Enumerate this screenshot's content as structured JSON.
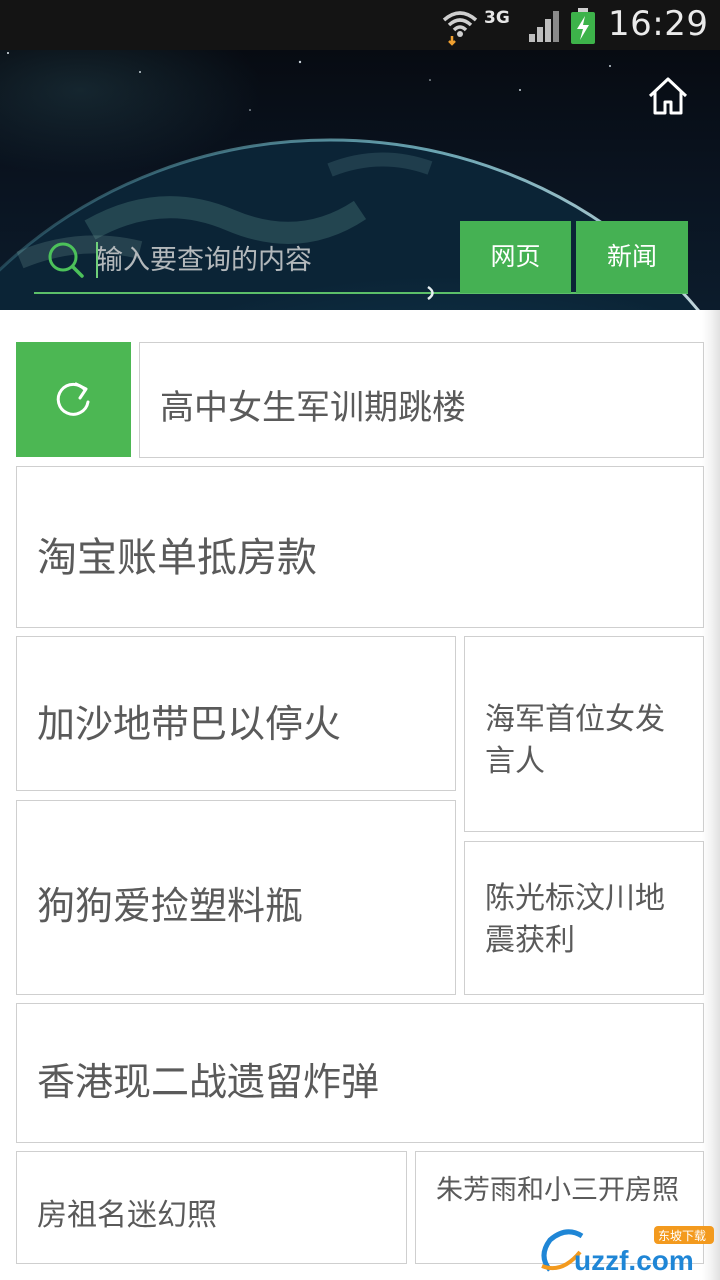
{
  "status_bar": {
    "network": "3G",
    "time": "16:29",
    "icons": [
      "wifi-icon",
      "signal-icon",
      "battery-charging-icon"
    ]
  },
  "header": {
    "home_icon": "home-icon",
    "search": {
      "icon": "search-icon",
      "placeholder": "输入要查询的内容",
      "value": ""
    },
    "buttons": {
      "web": "网页",
      "news": "新闻"
    },
    "accent_color": "#45b153"
  },
  "hot_list": {
    "refresh_icon": "refresh-icon",
    "items": [
      "高中女生军训期跳楼",
      "淘宝账单抵房款",
      "加沙地带巴以停火",
      "海军首位女发言人",
      "狗狗爱捡塑料瓶",
      "陈光标汶川地震获利",
      "香港现二战遗留炸弹",
      "房祖名迷幻照",
      "朱芳雨和小三开房照"
    ]
  },
  "watermark": {
    "brand": "uzzf.com",
    "tag": "东坡下载"
  }
}
